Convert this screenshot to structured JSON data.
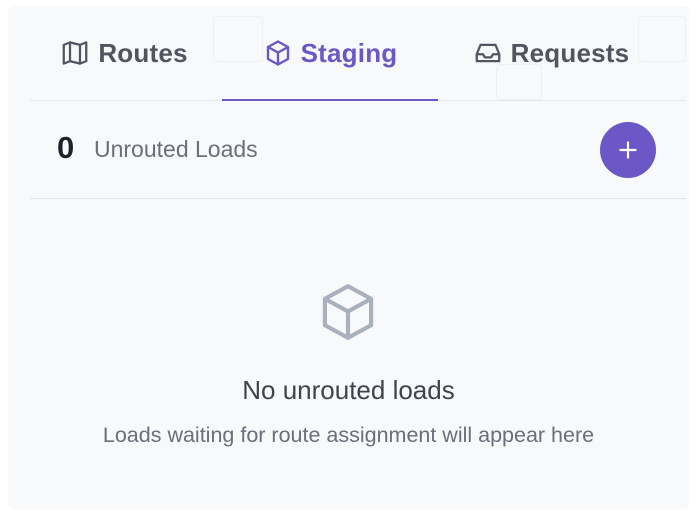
{
  "tabs": [
    {
      "label": "Routes",
      "icon": "map-icon",
      "active": false
    },
    {
      "label": "Staging",
      "icon": "box-icon",
      "active": true
    },
    {
      "label": "Requests",
      "icon": "inbox-icon",
      "active": false
    }
  ],
  "summary": {
    "count": "0",
    "label": "Unrouted Loads",
    "add_icon": "plus-icon"
  },
  "empty_state": {
    "icon": "box-icon",
    "title": "No unrouted loads",
    "subtitle": "Loads waiting for route assignment will appear here"
  },
  "colors": {
    "accent": "#6b57c6",
    "tab_text": "#50555f",
    "muted_text": "#6a6f79",
    "divider": "#e4e6ec",
    "panel_bg": "#f8f9fb",
    "empty_icon": "#aab0bc"
  }
}
